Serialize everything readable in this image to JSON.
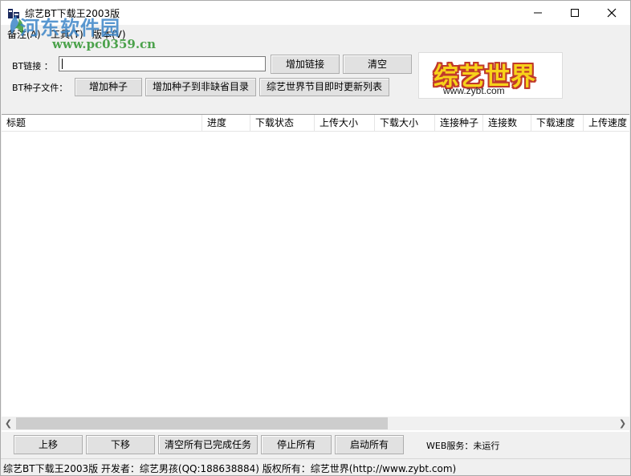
{
  "window": {
    "title": "综艺BT下载王2003版"
  },
  "watermark": {
    "title": "河东软件园",
    "url": "www.pc0359.cn"
  },
  "menu": [
    "备注(A)",
    "工具(T)",
    "版本(V)"
  ],
  "top": {
    "bt_link_label": "BT链接 ：",
    "bt_link_value": "",
    "add_link_button": "增加链接",
    "clear_button": "清空",
    "seed_file_label": "BT种子文件：",
    "add_seed_button": "增加种子",
    "add_seed_default_button": "增加种子到非缺省目录",
    "update_list_button": "综艺世界节目即时更新列表"
  },
  "logo": {
    "main": "综艺世界",
    "sub": "www.zybt.com"
  },
  "columns": [
    "标题",
    "进度",
    "下载状态",
    "上传大小",
    "下载大小",
    "连接种子",
    "连接数",
    "下载速度",
    "上传速度"
  ],
  "bottom": {
    "move_up": "上移",
    "move_down": "下移",
    "clear_completed": "清空所有已完成任务",
    "stop_all": "停止所有",
    "start_all": "启动所有",
    "web_service": "WEB服务：未运行"
  },
  "status": "综艺BT下载王2003版  开发者：综艺男孩(QQ:188638884) 版权所有：综艺世界(http://www.zybt.com)"
}
